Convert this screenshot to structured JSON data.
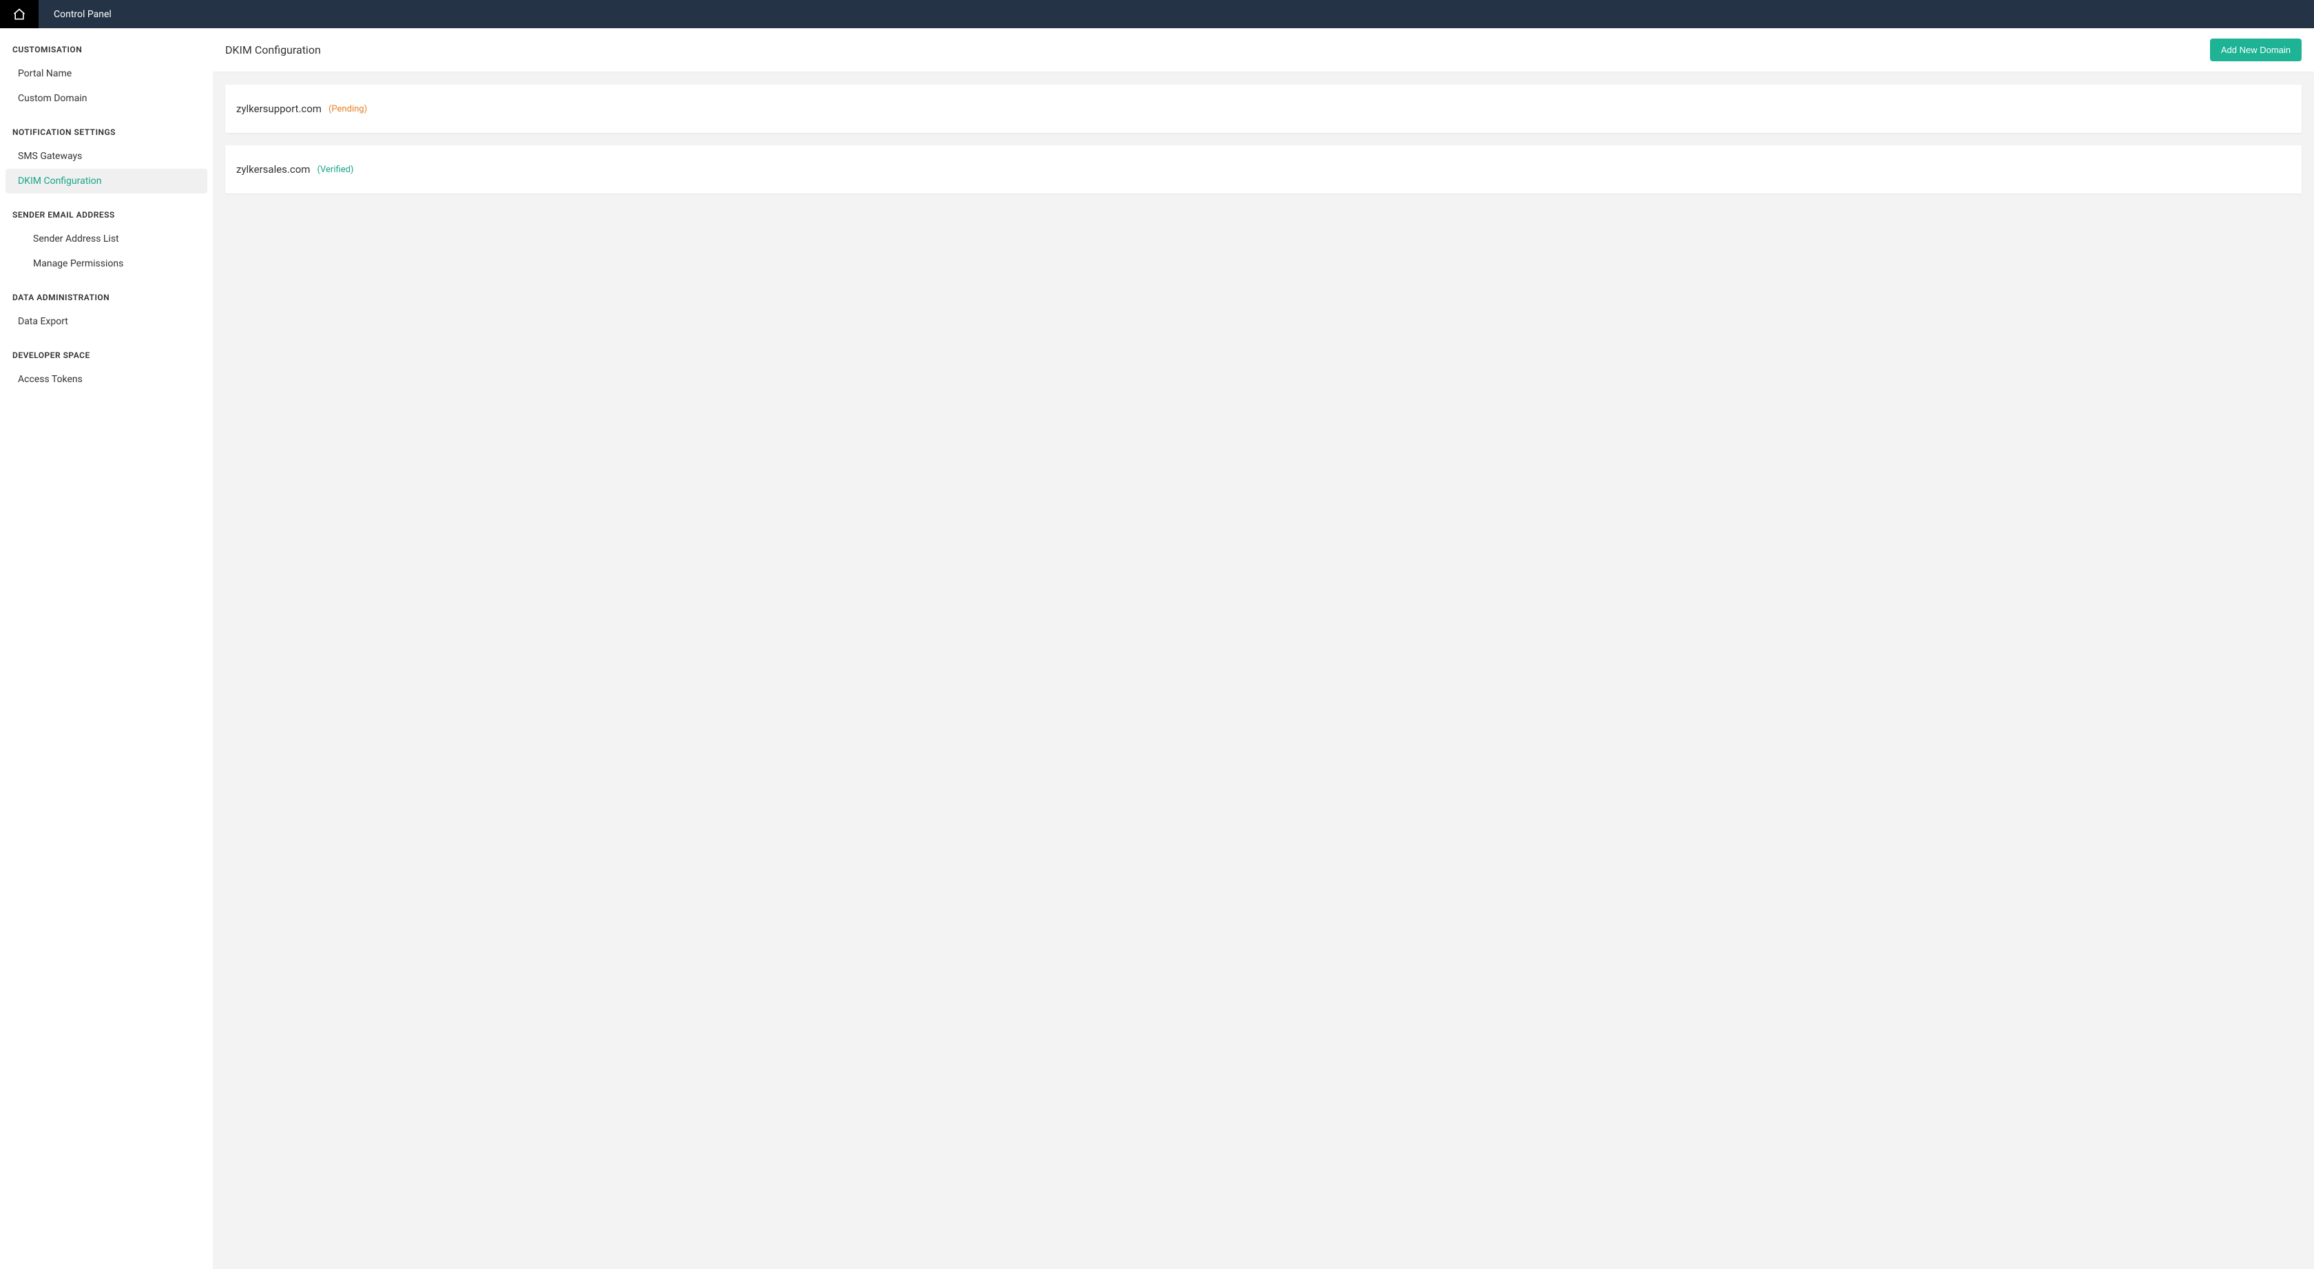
{
  "header": {
    "title": "Control Panel"
  },
  "sidebar": {
    "sections": [
      {
        "title": "CUSTOMISATION",
        "items": [
          {
            "label": "Portal Name",
            "active": false,
            "nested": false
          },
          {
            "label": "Custom Domain",
            "active": false,
            "nested": false
          }
        ]
      },
      {
        "title": "NOTIFICATION SETTINGS",
        "items": [
          {
            "label": "SMS Gateways",
            "active": false,
            "nested": false
          },
          {
            "label": "DKIM Configuration",
            "active": true,
            "nested": false
          }
        ]
      },
      {
        "title": "SENDER EMAIL ADDRESS",
        "items": [
          {
            "label": "Sender Address List",
            "active": false,
            "nested": true
          },
          {
            "label": "Manage Permissions",
            "active": false,
            "nested": true
          }
        ]
      },
      {
        "title": "DATA ADMINISTRATION",
        "items": [
          {
            "label": "Data Export",
            "active": false,
            "nested": false
          }
        ]
      },
      {
        "title": "DEVELOPER SPACE",
        "items": [
          {
            "label": "Access Tokens",
            "active": false,
            "nested": false
          }
        ]
      }
    ]
  },
  "main": {
    "page_title": "DKIM Configuration",
    "add_button": "Add New Domain",
    "domains": [
      {
        "name": "zylkersupport.com",
        "status": "(Pending)",
        "status_class": "status-pending"
      },
      {
        "name": "zylkersales.com",
        "status": "(Verified)",
        "status_class": "status-verified"
      }
    ]
  }
}
